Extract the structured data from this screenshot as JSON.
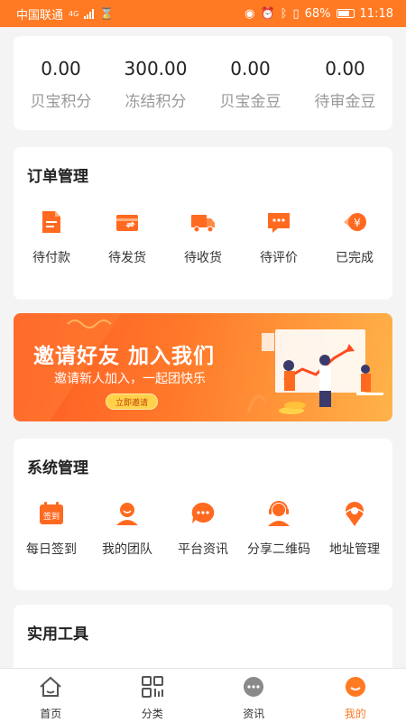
{
  "statusbar": {
    "carrier": "中国联通",
    "net": "4G",
    "battery": "68%",
    "time": "11:18"
  },
  "balances": [
    {
      "value": "0.00",
      "label": "贝宝积分"
    },
    {
      "value": "300.00",
      "label": "冻结积分"
    },
    {
      "value": "0.00",
      "label": "贝宝金豆"
    },
    {
      "value": "0.00",
      "label": "待审金豆"
    }
  ],
  "orders": {
    "title": "订单管理",
    "items": [
      {
        "label": "待付款",
        "icon": "payment-icon"
      },
      {
        "label": "待发货",
        "icon": "package-icon"
      },
      {
        "label": "待收货",
        "icon": "truck-icon"
      },
      {
        "label": "待评价",
        "icon": "comment-icon"
      },
      {
        "label": "已完成",
        "icon": "yen-coin-icon"
      }
    ]
  },
  "banner": {
    "headline": "邀请好友  加入我们",
    "subline": "邀请新人加入，一起团快乐",
    "button": "立即邀请"
  },
  "system": {
    "title": "系统管理",
    "items": [
      {
        "label": "每日签到",
        "icon": "checkin-calendar-icon",
        "badge": "签到"
      },
      {
        "label": "我的团队",
        "icon": "team-icon"
      },
      {
        "label": "平台资讯",
        "icon": "chat-bubble-icon"
      },
      {
        "label": "分享二维码",
        "icon": "headset-user-icon"
      },
      {
        "label": "地址管理",
        "icon": "location-pin-icon"
      }
    ]
  },
  "tools": {
    "title": "实用工具"
  },
  "tabbar": {
    "items": [
      {
        "label": "首页",
        "icon": "home-icon"
      },
      {
        "label": "分类",
        "icon": "category-icon"
      },
      {
        "label": "资讯",
        "icon": "news-icon"
      },
      {
        "label": "我的",
        "icon": "profile-icon"
      }
    ],
    "active": "我的"
  },
  "colors": {
    "accent": "#ff7a22",
    "icon_orange": "#ff6a20",
    "tab_gray": "#8a8a8a"
  }
}
